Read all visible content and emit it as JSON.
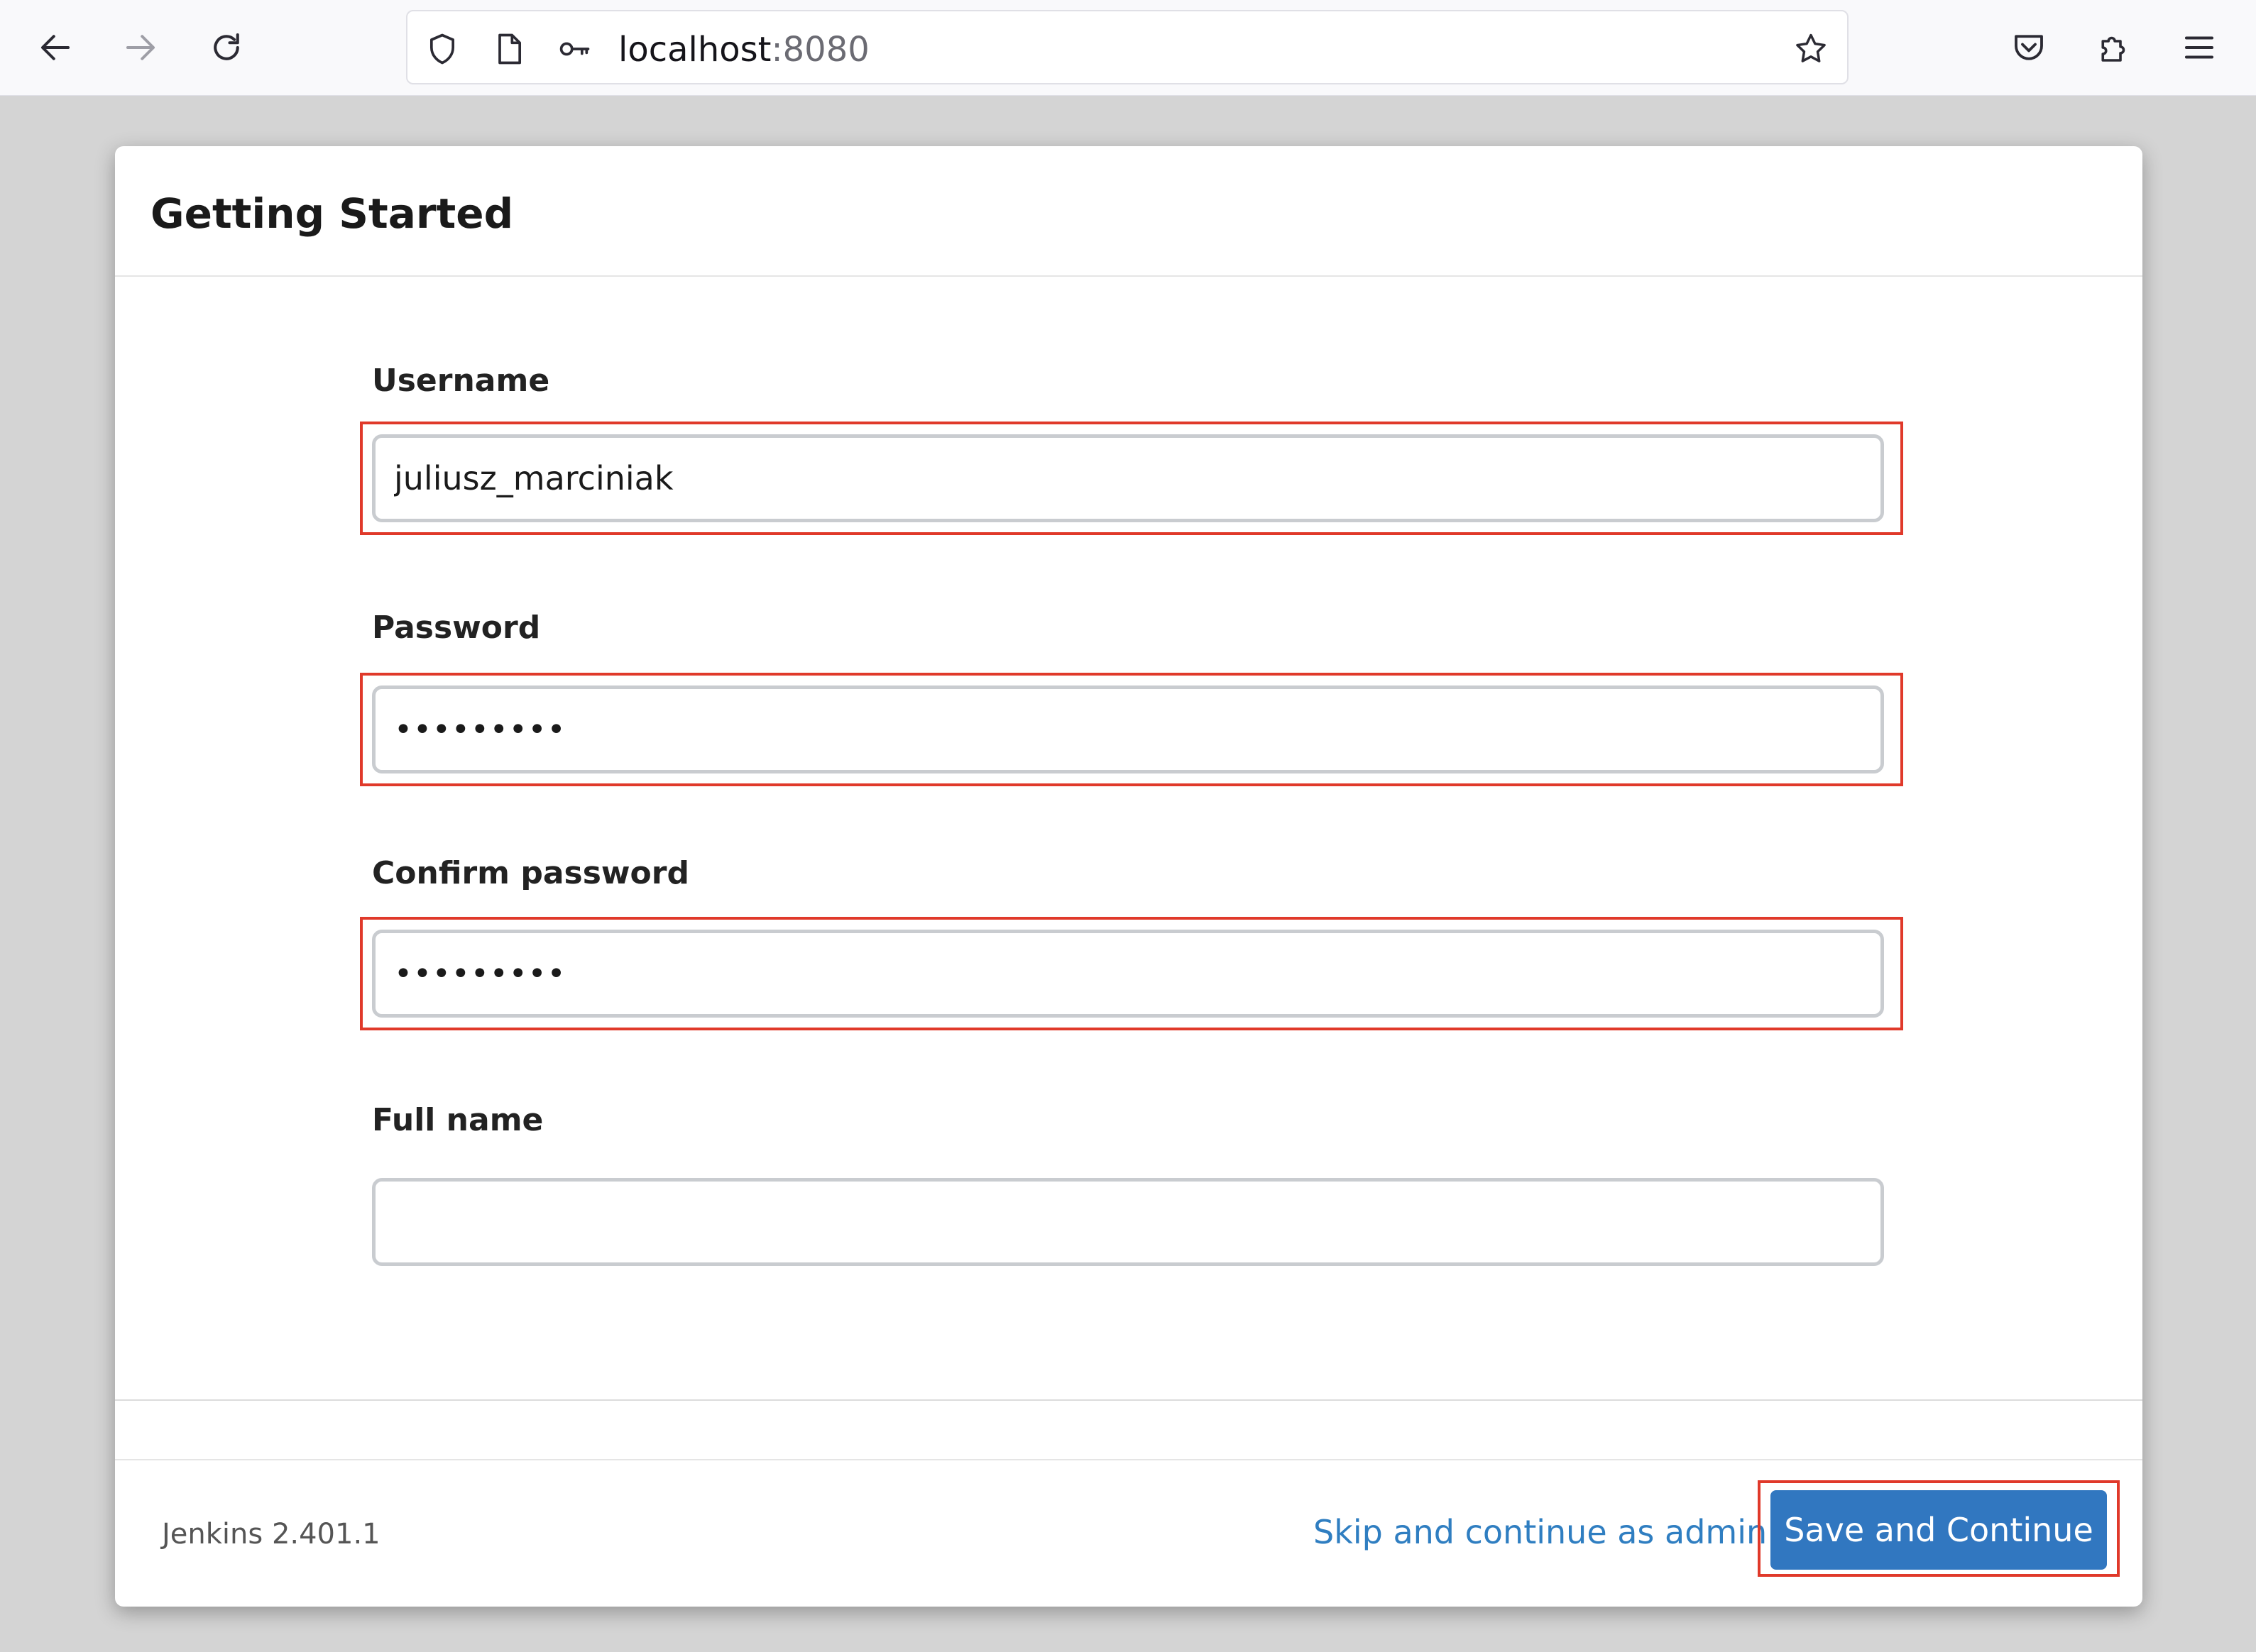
{
  "browser": {
    "url_host": "localhost",
    "url_port": ":8080",
    "icons": {
      "back": "arrow-left-icon",
      "forward": "arrow-right-icon",
      "reload": "reload-icon",
      "shield": "shield-icon",
      "page": "page-icon",
      "key": "key-icon",
      "bookmark": "star-icon",
      "pocket": "pocket-icon",
      "extensions": "puzzle-icon",
      "menu": "hamburger-icon"
    }
  },
  "dialog": {
    "title": "Getting Started",
    "fields": {
      "username": {
        "label": "Username",
        "value": "juliusz_marciniak"
      },
      "password": {
        "label": "Password",
        "value": "•••••••••"
      },
      "confirm_password": {
        "label": "Confirm password",
        "value": "•••••••••"
      },
      "full_name": {
        "label": "Full name",
        "value": ""
      }
    },
    "footer": {
      "version": "Jenkins 2.401.1",
      "skip_label": "Skip and continue as admin",
      "save_label": "Save and Continue"
    }
  },
  "colors": {
    "highlight": "#e0392a",
    "primary_button": "#3177c0",
    "link": "#2f7ec1"
  }
}
